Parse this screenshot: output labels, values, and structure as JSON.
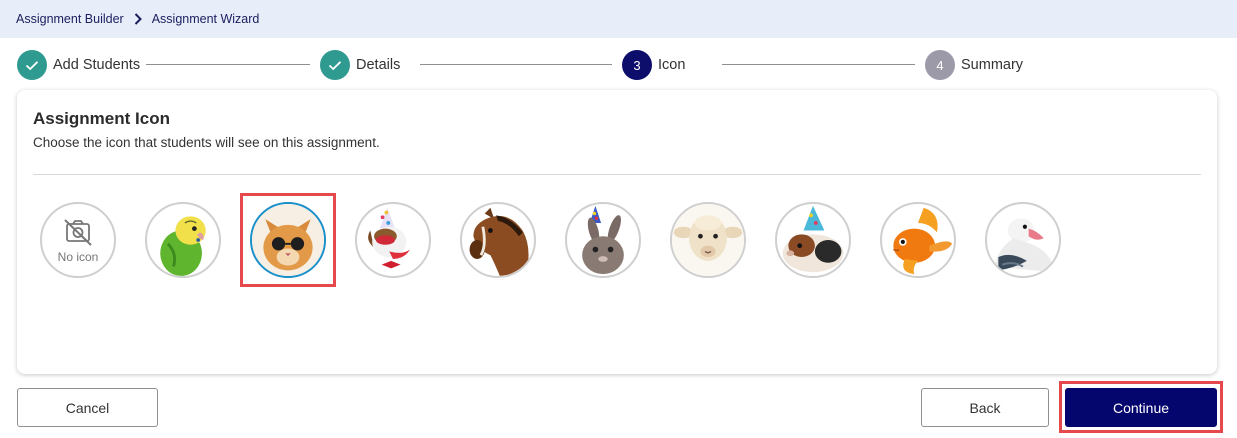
{
  "breadcrumb": {
    "items": [
      "Assignment Builder",
      "Assignment Wizard"
    ]
  },
  "stepper": {
    "steps": [
      {
        "number": "1",
        "label": "Add Students",
        "state": "done"
      },
      {
        "number": "2",
        "label": "Details",
        "state": "done"
      },
      {
        "number": "3",
        "label": "Icon",
        "state": "current"
      },
      {
        "number": "4",
        "label": "Summary",
        "state": "pending"
      }
    ]
  },
  "card": {
    "title": "Assignment Icon",
    "description": "Choose the icon that students will see on this assignment.",
    "no_icon_label": "No icon",
    "icons": [
      "no-icon",
      "budgie",
      "cat-sunglasses",
      "dog-party-hat",
      "horse",
      "bunny-party-hat",
      "sheep",
      "guinea-pig-party-hat",
      "goldfish",
      "duck"
    ],
    "selected": "cat-sunglasses"
  },
  "actions": {
    "cancel_label": "Cancel",
    "back_label": "Back",
    "continue_label": "Continue"
  },
  "colors": {
    "breadcrumb_bg": "#e8edfa",
    "step_done": "#2f9a8f",
    "step_current": "#0d0d6b",
    "step_pending": "#9c9aa8",
    "primary": "#05056e",
    "highlight": "#e5484d",
    "selected_ring": "#1a8fc9"
  }
}
